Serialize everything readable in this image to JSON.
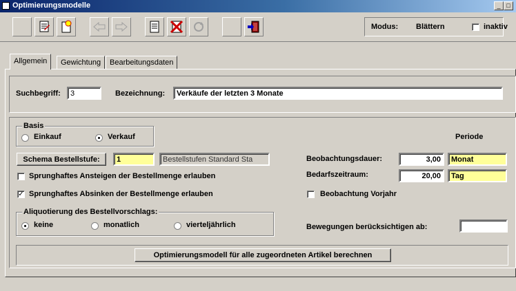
{
  "window": {
    "title": "Optimierungsmodelle"
  },
  "toolbar": {
    "mode_label": "Modus:",
    "mode_value": "Blättern",
    "inactive_label": "inaktiv",
    "inactive_checked": false
  },
  "tabs": [
    {
      "label": "Allgemein",
      "active": true
    },
    {
      "label": "Gewichtung",
      "active": false
    },
    {
      "label": "Bearbeitungsdaten",
      "active": false
    }
  ],
  "search": {
    "label": "Suchbegriff:",
    "value": "3"
  },
  "description": {
    "label": "Bezeichnung:",
    "value": "Verkäufe der letzten 3 Monate"
  },
  "basis": {
    "legend": "Basis",
    "options": [
      {
        "label": "Einkauf",
        "selected": false
      },
      {
        "label": "Verkauf",
        "selected": true
      }
    ]
  },
  "schema": {
    "button": "Schema Bestellstufe:",
    "code": "1",
    "name": "Bestellstufen Standard Sta"
  },
  "options": {
    "increase": {
      "label": "Sprunghaftes Ansteigen der Bestellmenge erlauben",
      "checked": false
    },
    "decrease": {
      "label": "Sprunghaftes Absinken der Bestellmenge erlauben",
      "checked": true
    }
  },
  "aliquot": {
    "legend": "Aliquotierung des Bestellvorschlags:",
    "options": [
      {
        "label": "keine",
        "selected": true
      },
      {
        "label": "monatlich",
        "selected": false
      },
      {
        "label": "vierteljährlich",
        "selected": false
      }
    ]
  },
  "period": {
    "header": "Periode",
    "observation": {
      "label": "Beobachtungsdauer:",
      "value": "3,00",
      "unit": "Monat"
    },
    "demand": {
      "label": "Bedarfszeitraum:",
      "value": "20,00",
      "unit": "Tag"
    },
    "prev_year": {
      "label": "Beobachtung Vorjahr",
      "checked": false
    }
  },
  "movements": {
    "label": "Bewegungen berücksichtigen ab:",
    "value": ""
  },
  "calculate_button": "Optimierungsmodell für alle zugeordneten Artikel berechnen"
}
